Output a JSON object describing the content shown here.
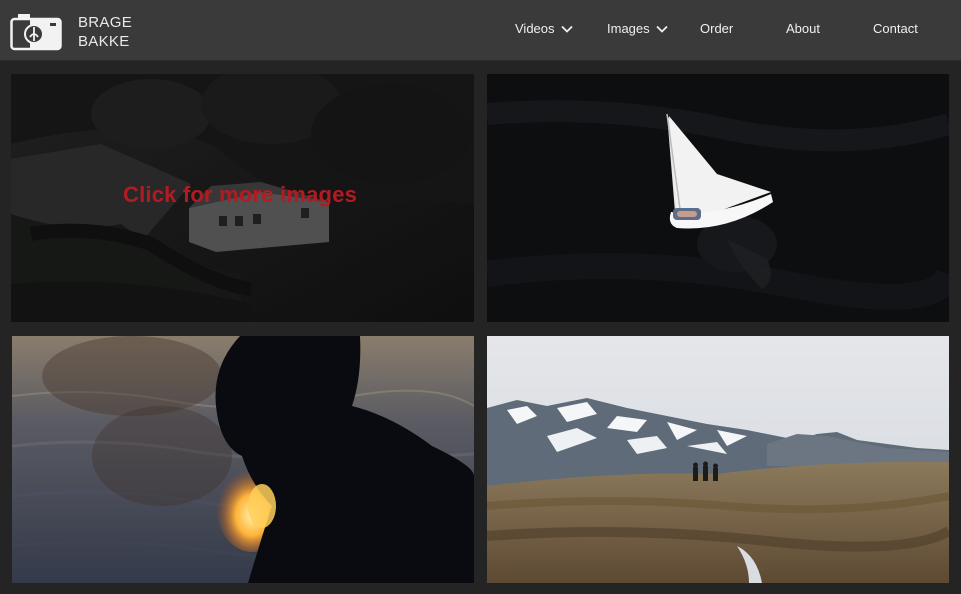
{
  "brand": {
    "line1": "BRAGE",
    "line2": "BAKKE",
    "logo_icon": "camera-icon"
  },
  "nav": {
    "items": [
      {
        "label": "Videos",
        "has_dropdown": true
      },
      {
        "label": "Images",
        "has_dropdown": true
      },
      {
        "label": "Order",
        "has_dropdown": false
      },
      {
        "label": "About",
        "has_dropdown": false
      },
      {
        "label": "Contact",
        "has_dropdown": false
      }
    ]
  },
  "gallery": {
    "overlay_caption": "Click for more images",
    "tiles": [
      {
        "subject": "aerial view of a house in dark forest"
      },
      {
        "subject": "sailboat on dark water"
      },
      {
        "subject": "silhouette of a person with fire at sunset by the sea"
      },
      {
        "subject": "hikers on a mountain plateau with snowy peaks"
      }
    ]
  },
  "colors": {
    "header_bg": "#3a3a3a",
    "page_bg": "#242424",
    "caption": "#b31b22"
  }
}
